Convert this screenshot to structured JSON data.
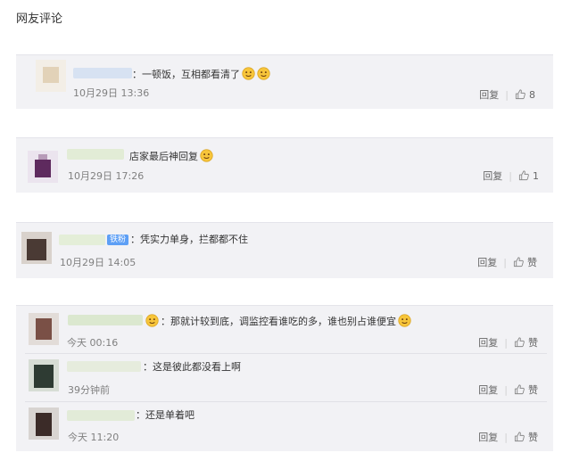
{
  "page": {
    "title": "网友评论"
  },
  "comments": [
    {
      "text": "：一顿饭，互相都看清了",
      "time": "10月29日 13:36",
      "reply": "回复",
      "likes": "8"
    },
    {
      "text": "店家最后神回复",
      "time": "10月29日 17:26",
      "reply": "回复",
      "likes": "1"
    },
    {
      "badge": "铁粉",
      "text": "：凭实力单身，拦都都不住",
      "time": "10月29日 14:05",
      "reply": "回复",
      "likes": "赞"
    }
  ],
  "thread": [
    {
      "text": "：那就计较到底，调监控看谁吃的多，谁也别占谁便宜",
      "time": "今天 00:16",
      "reply": "回复",
      "likes": "赞"
    },
    {
      "text": "：这是彼此都没看上啊",
      "time": "39分钟前",
      "reply": "回复",
      "likes": "赞"
    },
    {
      "text": "：还是单着吧",
      "time": "今天 11:20",
      "reply": "回复",
      "likes": "赞"
    }
  ],
  "icons": {
    "like": "thumbs-up-icon",
    "emoji": "face-emoji-icon",
    "avatar": "blurred-avatar"
  },
  "colors": {
    "card_bg": "#f2f2f5",
    "badge": "#5d9ff5",
    "time": "#808080",
    "emoji": "#f7c53a"
  }
}
